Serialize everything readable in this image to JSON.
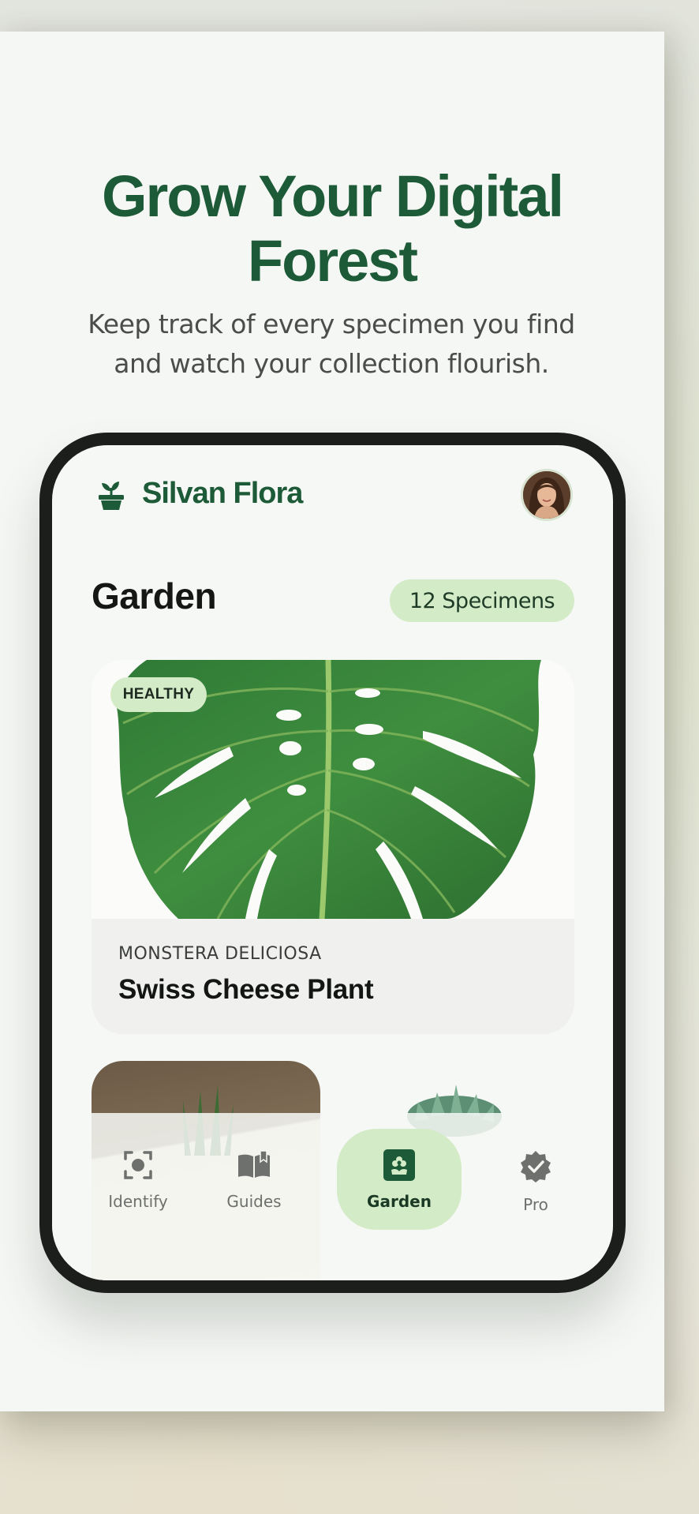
{
  "hero": {
    "headline_line1": "Grow Your Digital",
    "headline_line2": "Forest",
    "subhead_line1": "Keep track of every specimen you find",
    "subhead_line2": "and watch your collection flourish."
  },
  "app": {
    "brand": "Silvan Flora",
    "section_title": "Garden",
    "specimen_count": "12 Specimens"
  },
  "featured_card": {
    "status": "HEALTHY",
    "scientific_name": "MONSTERA DELICIOSA",
    "common_name": "Swiss Cheese Plant"
  },
  "nav": {
    "items": [
      {
        "label": "Identify",
        "icon": "scan-icon",
        "active": false
      },
      {
        "label": "Guides",
        "icon": "book-icon",
        "active": false
      },
      {
        "label": "Garden",
        "icon": "garden-icon",
        "active": true
      },
      {
        "label": "Pro",
        "icon": "verified-badge-icon",
        "active": false
      }
    ]
  },
  "colors": {
    "brand_green": "#1d5a37",
    "accent_light_green": "#d4ebc7",
    "text_dark": "#151715",
    "phone_frame": "#1c1e1c"
  }
}
